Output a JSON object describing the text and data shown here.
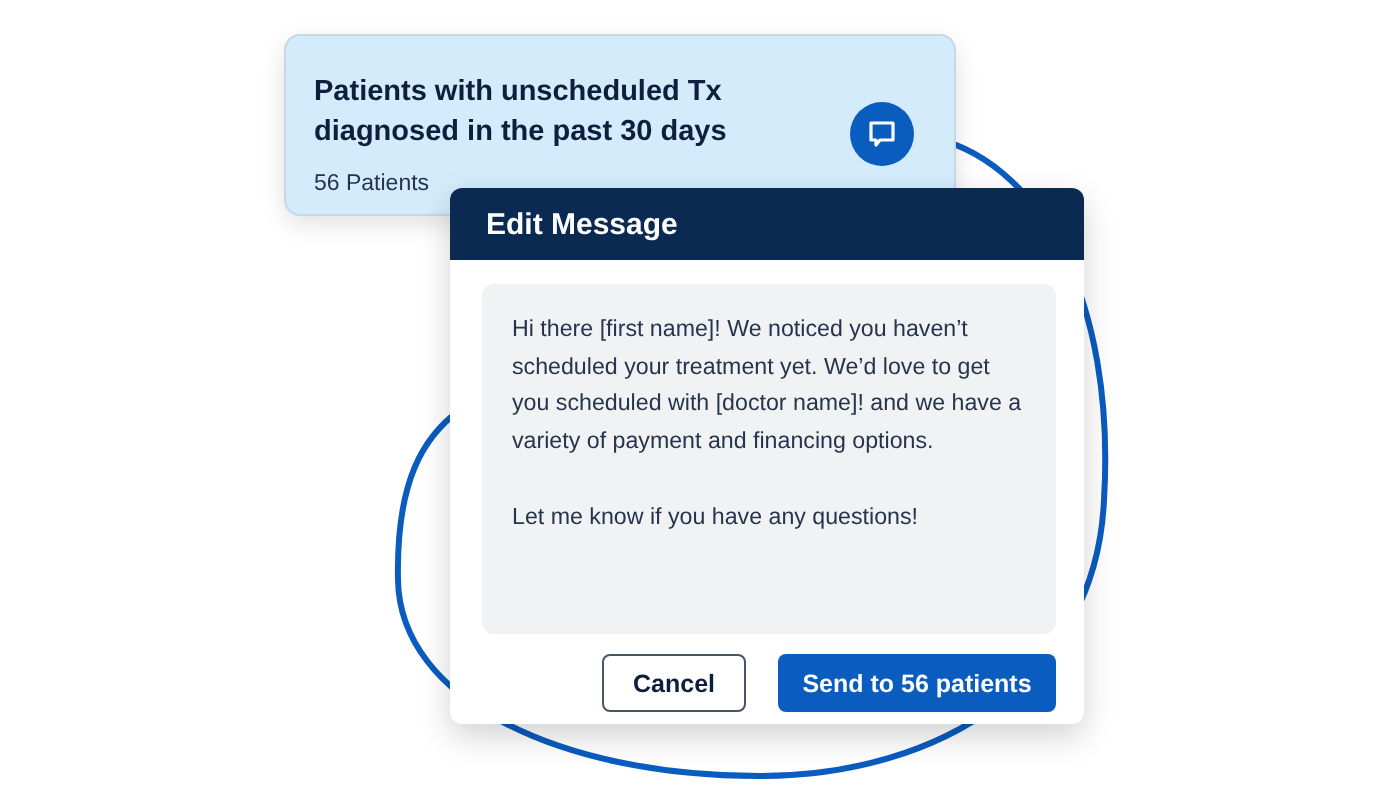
{
  "segment_card": {
    "title": "Patients with unscheduled Tx diagnosed in the past 30 days",
    "count": "56 Patients"
  },
  "dialog": {
    "title": "Edit Message",
    "message": "Hi there [first name]! We noticed you haven’t scheduled your treatment yet. We’d love to get you scheduled with [doctor name]! and we have a variety of payment and financing options.\n\nLet me know if you have any questions!",
    "buttons": [
      {
        "label": "Cancel",
        "kind": "secondary"
      },
      {
        "label": "Send to 56 patients",
        "kind": "primary"
      }
    ]
  }
}
